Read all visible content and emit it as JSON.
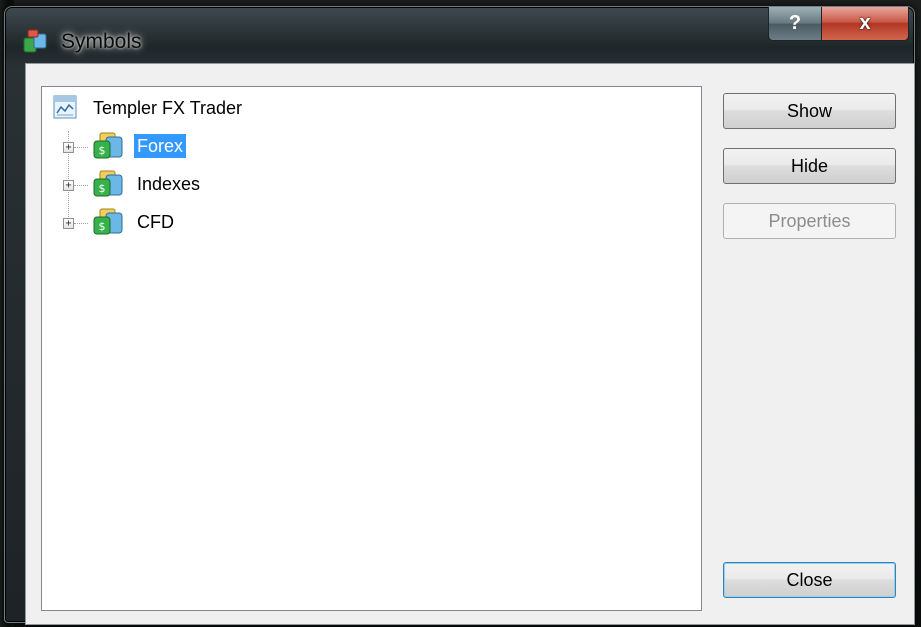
{
  "window": {
    "title": "Symbols",
    "help_label": "?",
    "close_label": "x"
  },
  "tree": {
    "root": {
      "label": "Templer FX Trader",
      "icon": "server-chart-icon"
    },
    "children": [
      {
        "label": "Forex",
        "icon": "symbol-folder-icon",
        "selected": true,
        "expander": "+"
      },
      {
        "label": "Indexes",
        "icon": "symbol-folder-icon",
        "selected": false,
        "expander": "+"
      },
      {
        "label": "CFD",
        "icon": "symbol-folder-icon",
        "selected": false,
        "expander": "+"
      }
    ]
  },
  "buttons": {
    "show": "Show",
    "hide": "Hide",
    "properties": "Properties",
    "close": "Close"
  },
  "colors": {
    "selection": "#3399ff",
    "close_button": "#c8594a"
  }
}
